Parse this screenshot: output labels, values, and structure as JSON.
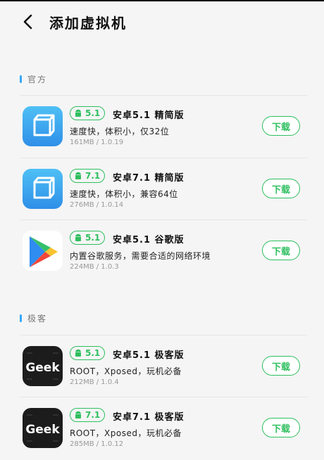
{
  "header": {
    "title": "添加虚拟机"
  },
  "sections": [
    {
      "label": "官方"
    },
    {
      "label": "极客"
    }
  ],
  "apps": [
    {
      "version": "5.1",
      "name": "安卓5.1 精简版",
      "desc": "速度快，体积小，仅32位",
      "meta": "161MB / 1.0.19",
      "download": "下载",
      "icon": "cube-icon"
    },
    {
      "version": "7.1",
      "name": "安卓7.1 精简版",
      "desc": "速度快，体积小，兼容64位",
      "meta": "276MB / 1.0.14",
      "download": "下载",
      "icon": "cube-icon"
    },
    {
      "version": "5.1",
      "name": "安卓5.1 谷歌版",
      "desc": "内置谷歌服务，需要合适的网络环境",
      "meta": "224MB / 1.0.3",
      "download": "下载",
      "icon": "play-store-icon"
    },
    {
      "version": "5.1",
      "name": "安卓5.1 极客版",
      "desc": "ROOT，Xposed，玩机必备",
      "meta": "212MB / 1.0.4",
      "download": "下载",
      "icon": "geek-icon",
      "icon_text": "Geek"
    },
    {
      "version": "7.1",
      "name": "安卓7.1 极客版",
      "desc": "ROOT，Xposed，玩机必备",
      "meta": "285MB / 1.0.12",
      "download": "下载",
      "icon": "geek-icon",
      "icon_text": "Geek"
    }
  ],
  "colors": {
    "accent": "#2fbf5f",
    "section_bar": "#35a8f5",
    "background": "#f5f5f5"
  }
}
